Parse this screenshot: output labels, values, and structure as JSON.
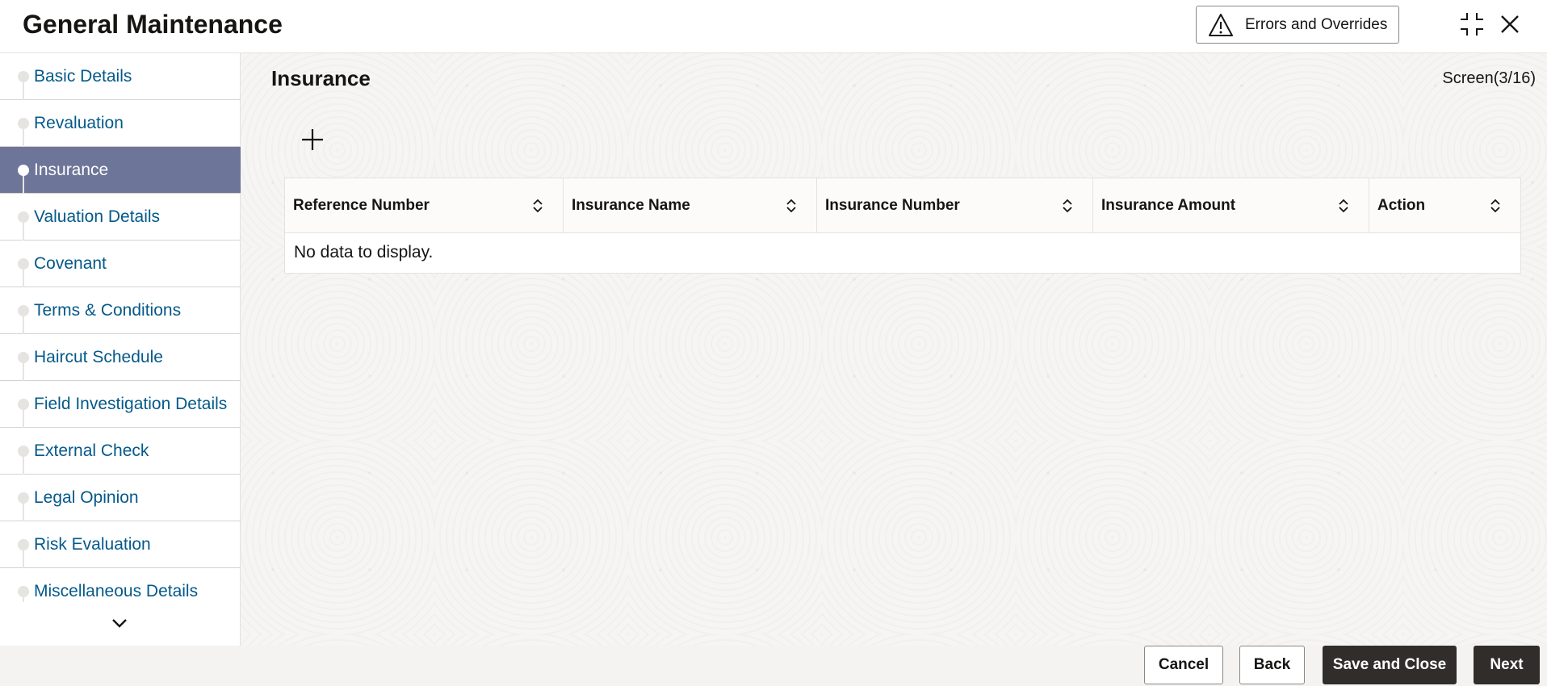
{
  "header": {
    "title": "General Maintenance",
    "errors_button_label": "Errors and Overrides",
    "icons": {
      "errors": "warning-triangle-icon",
      "shrink": "shrink-icon",
      "close": "close-icon"
    }
  },
  "sidebar": {
    "items": [
      {
        "label": "Basic Details",
        "active": false
      },
      {
        "label": "Revaluation",
        "active": false
      },
      {
        "label": "Insurance",
        "active": true
      },
      {
        "label": "Valuation Details",
        "active": false
      },
      {
        "label": "Covenant",
        "active": false
      },
      {
        "label": "Terms & Conditions",
        "active": false
      },
      {
        "label": "Haircut Schedule",
        "active": false
      },
      {
        "label": "Field Investigation Details",
        "active": false
      },
      {
        "label": "External Check",
        "active": false
      },
      {
        "label": "Legal Opinion",
        "active": false
      },
      {
        "label": "Risk Evaluation",
        "active": false
      },
      {
        "label": "Miscellaneous Details",
        "active": false
      }
    ],
    "active_color": "#6d7599",
    "link_color": "#04598a"
  },
  "main": {
    "section_title": "Insurance",
    "screen_indicator": "Screen(3/16)",
    "table": {
      "columns": [
        "Reference Number",
        "Insurance Name",
        "Insurance Number",
        "Insurance Amount",
        "Action"
      ],
      "empty_text": "No data to display."
    }
  },
  "footer": {
    "cancel": "Cancel",
    "back": "Back",
    "save_and_close": "Save and Close",
    "next": "Next"
  }
}
